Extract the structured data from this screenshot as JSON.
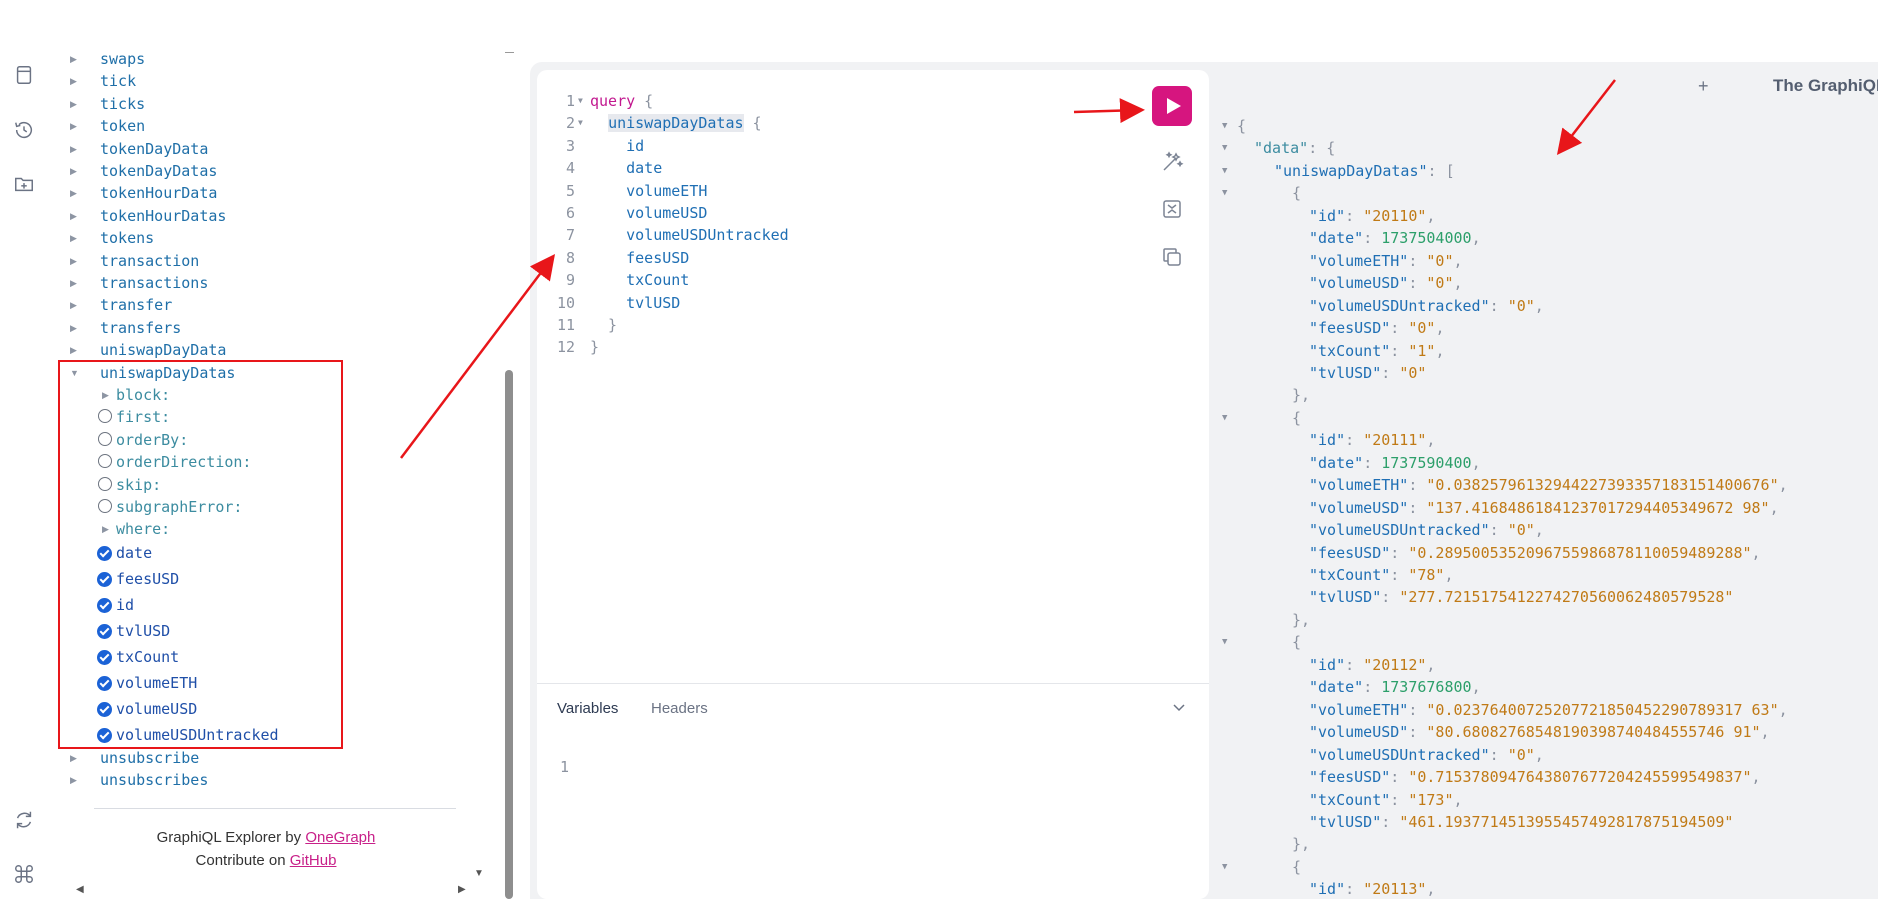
{
  "explorer": {
    "items": [
      {
        "label": "swaps",
        "kind": "type"
      },
      {
        "label": "tick",
        "kind": "type"
      },
      {
        "label": "ticks",
        "kind": "type"
      },
      {
        "label": "token",
        "kind": "type"
      },
      {
        "label": "tokenDayData",
        "kind": "type"
      },
      {
        "label": "tokenDayDatas",
        "kind": "type"
      },
      {
        "label": "tokenHourData",
        "kind": "type"
      },
      {
        "label": "tokenHourDatas",
        "kind": "type"
      },
      {
        "label": "tokens",
        "kind": "type"
      },
      {
        "label": "transaction",
        "kind": "type"
      },
      {
        "label": "transactions",
        "kind": "type"
      },
      {
        "label": "transfer",
        "kind": "type"
      },
      {
        "label": "transfers",
        "kind": "type"
      },
      {
        "label": "uniswapDayData",
        "kind": "type"
      }
    ],
    "expanded": {
      "label": "uniswapDayDatas",
      "args": [
        {
          "label": "block:",
          "kind": "caret"
        },
        {
          "label": "first:",
          "kind": "radio"
        },
        {
          "label": "orderBy:",
          "kind": "radio"
        },
        {
          "label": "orderDirection:",
          "kind": "radio"
        },
        {
          "label": "skip:",
          "kind": "radio"
        },
        {
          "label": "subgraphError:",
          "kind": "radio"
        },
        {
          "label": "where:",
          "kind": "caret"
        }
      ],
      "fields": [
        "date",
        "feesUSD",
        "id",
        "tvlUSD",
        "txCount",
        "volumeETH",
        "volumeUSD",
        "volumeUSDUntracked"
      ]
    },
    "after": [
      "unsubscribe",
      "unsubscribes"
    ],
    "footer": {
      "line1_prefix": "GraphiQL Explorer by ",
      "line1_link": "OneGraph",
      "line2_prefix": "Contribute on ",
      "line2_link": "GitHub"
    }
  },
  "editor": {
    "line_numbers": [
      "1",
      "2",
      "3",
      "4",
      "5",
      "6",
      "7",
      "8",
      "9",
      "10",
      "11",
      "12"
    ],
    "keyword": "query",
    "root_field": "uniswapDayDatas",
    "fields": [
      "id",
      "date",
      "volumeETH",
      "volumeUSD",
      "volumeUSDUntracked",
      "feesUSD",
      "txCount",
      "tvlUSD"
    ],
    "open_brace": "{",
    "close_brace": "}"
  },
  "variables": {
    "tab_variables": "Variables",
    "tab_headers": "Headers",
    "line1": "1"
  },
  "result_lines": [
    {
      "fold": true,
      "indent": 0,
      "parts": [
        [
          "jp",
          "{"
        ]
      ]
    },
    {
      "fold": true,
      "indent": 1,
      "parts": [
        [
          "jd",
          "\"data\""
        ],
        [
          "jp",
          ": {"
        ]
      ]
    },
    {
      "fold": true,
      "indent": 2,
      "parts": [
        [
          "jk",
          "\"uniswapDayDatas\""
        ],
        [
          "jp",
          ": ["
        ]
      ]
    },
    {
      "fold": true,
      "indent": 3,
      "parts": [
        [
          "jp",
          "{"
        ]
      ]
    },
    {
      "indent": 4,
      "parts": [
        [
          "jk",
          "\"id\""
        ],
        [
          "jp",
          ": "
        ],
        [
          "js",
          "\"20110\""
        ],
        [
          "jp",
          ","
        ]
      ]
    },
    {
      "indent": 4,
      "parts": [
        [
          "jk",
          "\"date\""
        ],
        [
          "jp",
          ": "
        ],
        [
          "jn",
          "1737504000"
        ],
        [
          "jp",
          ","
        ]
      ]
    },
    {
      "indent": 4,
      "parts": [
        [
          "jk",
          "\"volumeETH\""
        ],
        [
          "jp",
          ": "
        ],
        [
          "js",
          "\"0\""
        ],
        [
          "jp",
          ","
        ]
      ]
    },
    {
      "indent": 4,
      "parts": [
        [
          "jk",
          "\"volumeUSD\""
        ],
        [
          "jp",
          ": "
        ],
        [
          "js",
          "\"0\""
        ],
        [
          "jp",
          ","
        ]
      ]
    },
    {
      "indent": 4,
      "parts": [
        [
          "jk",
          "\"volumeUSDUntracked\""
        ],
        [
          "jp",
          ": "
        ],
        [
          "js",
          "\"0\""
        ],
        [
          "jp",
          ","
        ]
      ]
    },
    {
      "indent": 4,
      "parts": [
        [
          "jk",
          "\"feesUSD\""
        ],
        [
          "jp",
          ": "
        ],
        [
          "js",
          "\"0\""
        ],
        [
          "jp",
          ","
        ]
      ]
    },
    {
      "indent": 4,
      "parts": [
        [
          "jk",
          "\"txCount\""
        ],
        [
          "jp",
          ": "
        ],
        [
          "js",
          "\"1\""
        ],
        [
          "jp",
          ","
        ]
      ]
    },
    {
      "indent": 4,
      "parts": [
        [
          "jk",
          "\"tvlUSD\""
        ],
        [
          "jp",
          ": "
        ],
        [
          "js",
          "\"0\""
        ]
      ]
    },
    {
      "indent": 3,
      "parts": [
        [
          "jp",
          "},"
        ]
      ]
    },
    {
      "fold": true,
      "indent": 3,
      "parts": [
        [
          "jp",
          "{"
        ]
      ]
    },
    {
      "indent": 4,
      "parts": [
        [
          "jk",
          "\"id\""
        ],
        [
          "jp",
          ": "
        ],
        [
          "js",
          "\"20111\""
        ],
        [
          "jp",
          ","
        ]
      ]
    },
    {
      "indent": 4,
      "parts": [
        [
          "jk",
          "\"date\""
        ],
        [
          "jp",
          ": "
        ],
        [
          "jn",
          "1737590400"
        ],
        [
          "jp",
          ","
        ]
      ]
    },
    {
      "indent": 4,
      "parts": [
        [
          "jk",
          "\"volumeETH\""
        ],
        [
          "jp",
          ": "
        ],
        [
          "js",
          "\"0.03825796132944227393357183151400676\""
        ],
        [
          "jp",
          ","
        ]
      ]
    },
    {
      "indent": 4,
      "parts": [
        [
          "jk",
          "\"volumeUSD\""
        ],
        [
          "jp",
          ": "
        ],
        [
          "js",
          "\"137.41684861841237017294405349672 98\""
        ],
        [
          "jp",
          ","
        ]
      ]
    },
    {
      "indent": 4,
      "parts": [
        [
          "jk",
          "\"volumeUSDUntracked\""
        ],
        [
          "jp",
          ": "
        ],
        [
          "js",
          "\"0\""
        ],
        [
          "jp",
          ","
        ]
      ]
    },
    {
      "indent": 4,
      "parts": [
        [
          "jk",
          "\"feesUSD\""
        ],
        [
          "jp",
          ": "
        ],
        [
          "js",
          "\"0.2895005352096755986878110059489288\""
        ],
        [
          "jp",
          ","
        ]
      ]
    },
    {
      "indent": 4,
      "parts": [
        [
          "jk",
          "\"txCount\""
        ],
        [
          "jp",
          ": "
        ],
        [
          "js",
          "\"78\""
        ],
        [
          "jp",
          ","
        ]
      ]
    },
    {
      "indent": 4,
      "parts": [
        [
          "jk",
          "\"tvlUSD\""
        ],
        [
          "jp",
          ": "
        ],
        [
          "js",
          "\"277.7215175412274270560062480579528\""
        ]
      ]
    },
    {
      "indent": 3,
      "parts": [
        [
          "jp",
          "},"
        ]
      ]
    },
    {
      "fold": true,
      "indent": 3,
      "parts": [
        [
          "jp",
          "{"
        ]
      ]
    },
    {
      "indent": 4,
      "parts": [
        [
          "jk",
          "\"id\""
        ],
        [
          "jp",
          ": "
        ],
        [
          "js",
          "\"20112\""
        ],
        [
          "jp",
          ","
        ]
      ]
    },
    {
      "indent": 4,
      "parts": [
        [
          "jk",
          "\"date\""
        ],
        [
          "jp",
          ": "
        ],
        [
          "jn",
          "1737676800"
        ],
        [
          "jp",
          ","
        ]
      ]
    },
    {
      "indent": 4,
      "parts": [
        [
          "jk",
          "\"volumeETH\""
        ],
        [
          "jp",
          ": "
        ],
        [
          "js",
          "\"0.02376400725207721850452290789317 63\""
        ],
        [
          "jp",
          ","
        ]
      ]
    },
    {
      "indent": 4,
      "parts": [
        [
          "jk",
          "\"volumeUSD\""
        ],
        [
          "jp",
          ": "
        ],
        [
          "js",
          "\"80.68082768548190398740484555746 91\""
        ],
        [
          "jp",
          ","
        ]
      ]
    },
    {
      "indent": 4,
      "parts": [
        [
          "jk",
          "\"volumeUSDUntracked\""
        ],
        [
          "jp",
          ": "
        ],
        [
          "js",
          "\"0\""
        ],
        [
          "jp",
          ","
        ]
      ]
    },
    {
      "indent": 4,
      "parts": [
        [
          "jk",
          "\"feesUSD\""
        ],
        [
          "jp",
          ": "
        ],
        [
          "js",
          "\"0.7153780947643807677204245599549837\""
        ],
        [
          "jp",
          ","
        ]
      ]
    },
    {
      "indent": 4,
      "parts": [
        [
          "jk",
          "\"txCount\""
        ],
        [
          "jp",
          ": "
        ],
        [
          "js",
          "\"173\""
        ],
        [
          "jp",
          ","
        ]
      ]
    },
    {
      "indent": 4,
      "parts": [
        [
          "jk",
          "\"tvlUSD\""
        ],
        [
          "jp",
          ": "
        ],
        [
          "js",
          "\"461.1937714513955457492817875194509\""
        ]
      ]
    },
    {
      "indent": 3,
      "parts": [
        [
          "jp",
          "},"
        ]
      ]
    },
    {
      "fold": true,
      "indent": 3,
      "parts": [
        [
          "jp",
          "{"
        ]
      ]
    },
    {
      "indent": 4,
      "parts": [
        [
          "jk",
          "\"id\""
        ],
        [
          "jp",
          ": "
        ],
        [
          "js",
          "\"20113\""
        ],
        [
          "jp",
          ","
        ]
      ]
    }
  ],
  "header": {
    "plus": "+",
    "doc_title": "The GraphiQL"
  },
  "icons": {
    "rail": [
      "docs-icon",
      "history-icon",
      "folder-plus-icon",
      "refetch-icon",
      "shortcut-icon"
    ],
    "tools": [
      "prettify-icon",
      "merge-icon",
      "copy-icon"
    ]
  },
  "colors": {
    "run_button": "#d6157f",
    "highlight": "#e8161a",
    "keyword": "#c2188f",
    "field": "#1f6fb4",
    "string": "#c07a16",
    "number": "#2c9f6a"
  }
}
